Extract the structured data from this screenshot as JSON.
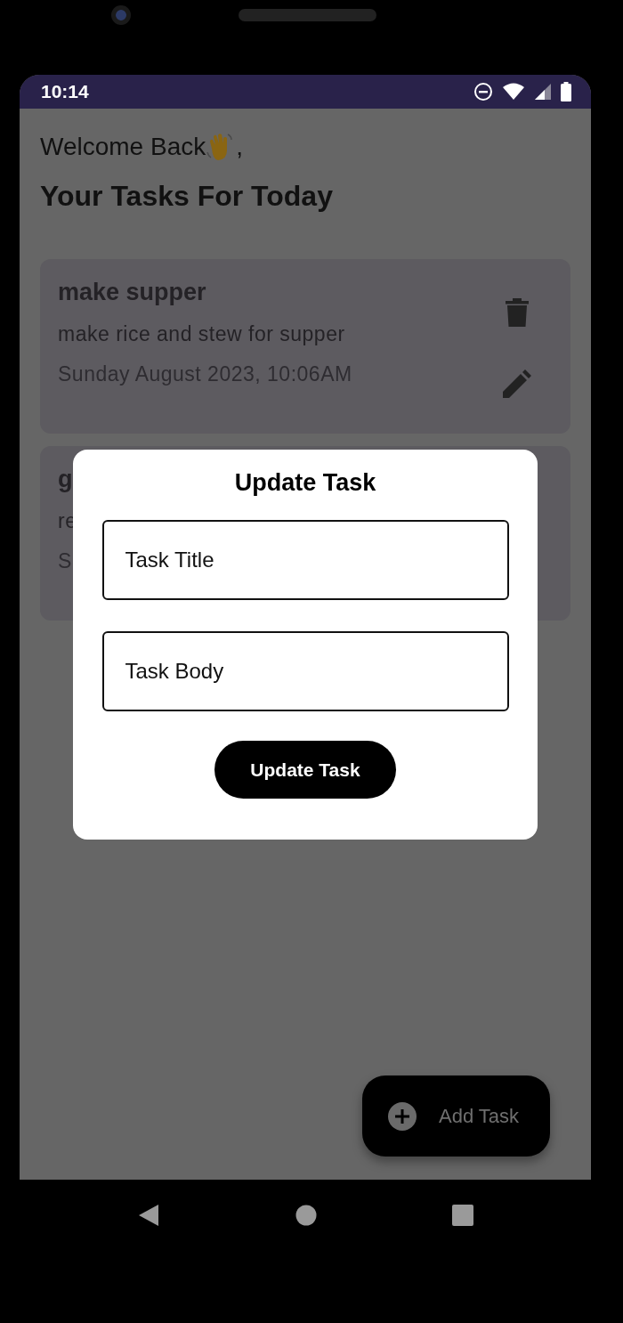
{
  "status_bar": {
    "time": "10:14"
  },
  "header": {
    "greeting": "Welcome Back",
    "greeting_suffix": ",",
    "title": "Your Tasks For Today"
  },
  "tasks": [
    {
      "title": "make supper",
      "body": "make rice and stew for supper",
      "date": "Sunday August 2023, 10:06AM"
    },
    {
      "title": "g",
      "body": "re",
      "date": "S"
    }
  ],
  "dialog": {
    "title": "Update Task",
    "fields": [
      {
        "placeholder": "Task Title"
      },
      {
        "placeholder": "Task Body"
      }
    ],
    "button": "Update Task"
  },
  "fab": {
    "label": "Add Task"
  }
}
